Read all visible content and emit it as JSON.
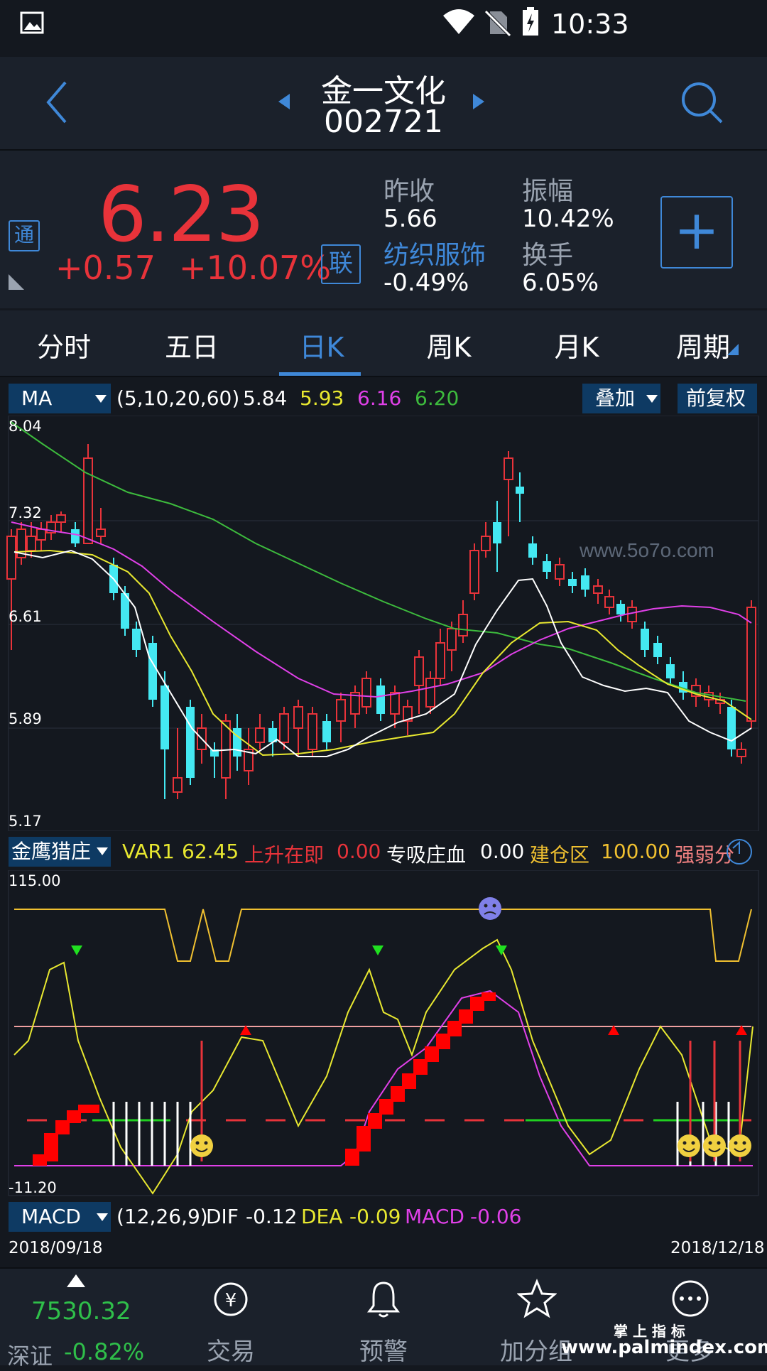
{
  "status_bar": {
    "time": "10:33"
  },
  "header": {
    "stock_name": "金一文化",
    "stock_code": "002721"
  },
  "quote": {
    "price": "6.23",
    "change": "+0.57",
    "change_pct": "+10.07%",
    "badge_tong": "通",
    "badge_lian": "联",
    "prev_close_label": "昨收",
    "prev_close": "5.66",
    "amplitude_label": "振幅",
    "amplitude": "10.42%",
    "sector_label": "纺织服饰",
    "sector_change": "-0.49%",
    "turnover_label": "换手",
    "turnover": "6.05%",
    "add_label": "+"
  },
  "tabs": [
    {
      "label": "分时"
    },
    {
      "label": "五日"
    },
    {
      "label": "日K"
    },
    {
      "label": "周K"
    },
    {
      "label": "月K"
    },
    {
      "label": "周期"
    }
  ],
  "ma_bar": {
    "selector": "MA",
    "params": "(5,10,20,60)",
    "v1": "5.84",
    "v2": "5.93",
    "v3": "6.16",
    "v4": "6.20",
    "overlay": "叠加",
    "adjust": "前复权"
  },
  "kline_axis": {
    "y1": "8.04",
    "y2": "7.32",
    "y3": "6.61",
    "y4": "5.89",
    "y5": "5.17"
  },
  "watermark": "www.5o7o.com",
  "ind2_bar": {
    "selector": "金鹰猎庄",
    "var1_label": "VAR1",
    "var1": "62.45",
    "up_label": "上升在即",
    "up": "0.00",
    "absorb_label": "专吸庄血",
    "absorb": "0.00",
    "build_label": "建仓区",
    "build": "100.00",
    "strength_label": "强弱分"
  },
  "ind2_axis": {
    "top": "115.00",
    "bottom": "-11.20"
  },
  "macd_bar": {
    "selector": "MACD",
    "params": "(12,26,9)",
    "dif_label": "DIF",
    "dif": "-0.12",
    "dea_label": "DEA",
    "dea": "-0.09",
    "macd_label": "MACD",
    "macd": "-0.06"
  },
  "dates": {
    "start": "2018/09/18",
    "end": "2018/12/18"
  },
  "bottom_nav": {
    "index_value": "7530.32",
    "index_name": "深证",
    "index_change": "-0.82%",
    "trade": "交易",
    "alert": "预警",
    "watchlist": "加分组",
    "more": "更多"
  },
  "brand": {
    "cn": "掌 上 指 标",
    "url": "www.palmindex.com"
  },
  "colors": {
    "up": "#e8333a",
    "down": "#44e8f2",
    "accent": "#3f88d8",
    "ma5": "#ffffff",
    "ma10": "#e8e830",
    "ma20": "#e040e8",
    "ma60": "#3dbb3d"
  }
}
